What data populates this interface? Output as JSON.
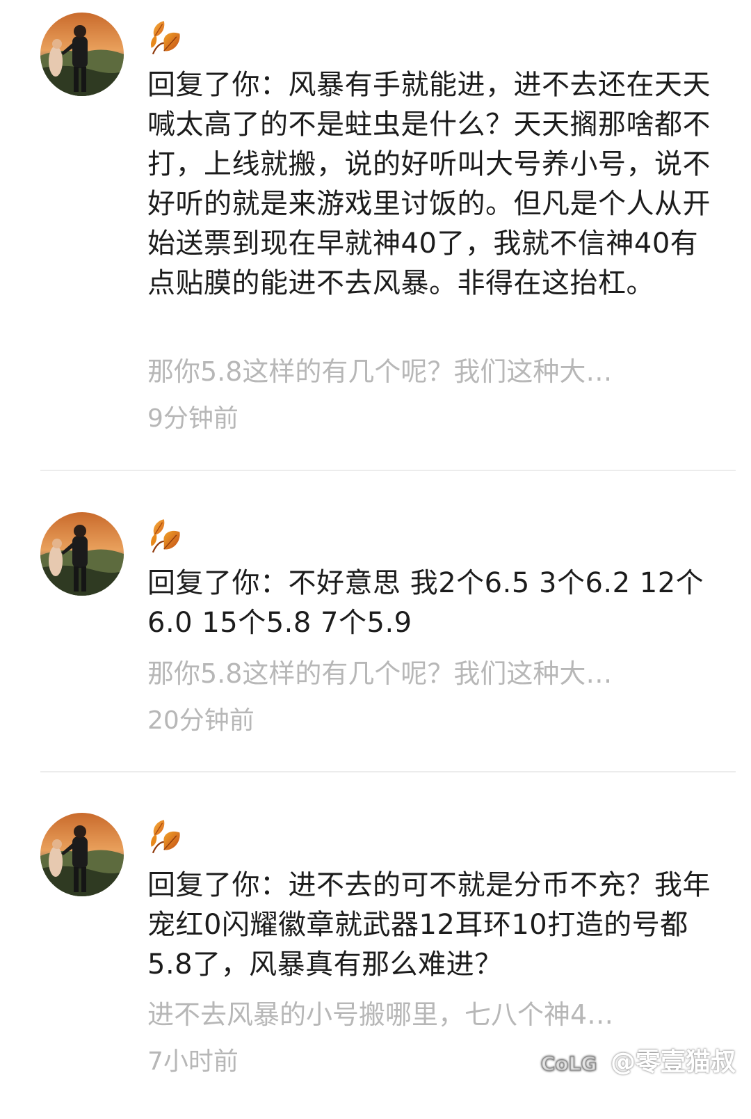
{
  "comments": [
    {
      "reply_text": "回复了你：风暴有手就能进，进不去还在天天喊太高了的不是蛀虫是什么？天天搁那啥都不打，上线就搬，说的好听叫大号养小号，说不好听的就是来游戏里讨饭的。但凡是个人从开始送票到现在早就神40了，我就不信神40有点贴膜的能进不去风暴。非得在这抬杠。",
      "quoted_text": "那你5.8这样的有几个呢？我们这种大…",
      "time": "9分钟前"
    },
    {
      "reply_text": "回复了你：不好意思  我2个6.5  3个6.2  12个6.0   15个5.8  7个5.9",
      "quoted_text": "那你5.8这样的有几个呢？我们这种大…",
      "time": "20分钟前"
    },
    {
      "reply_text": "回复了你：进不去的可不就是分币不充？我年宠红0闪耀徽章就武器12耳环10打造的号都5.8了，风暴真有那么难进？",
      "quoted_text": "进不去风暴的小号搬哪里，七八个神4…",
      "time": "7小时前"
    }
  ],
  "icons": {
    "avatar": "avatar-photo-icon",
    "nickname": "autumn-leaves-icon"
  },
  "watermark": {
    "logo_text": "CoLG",
    "handle": "@零壹猫叔"
  },
  "colors": {
    "text_primary": "#1c1c1c",
    "text_secondary": "#b7b7b7",
    "divider": "#ececec",
    "leaf_orange": "#e8891c",
    "leaf_dark": "#c4581a"
  }
}
